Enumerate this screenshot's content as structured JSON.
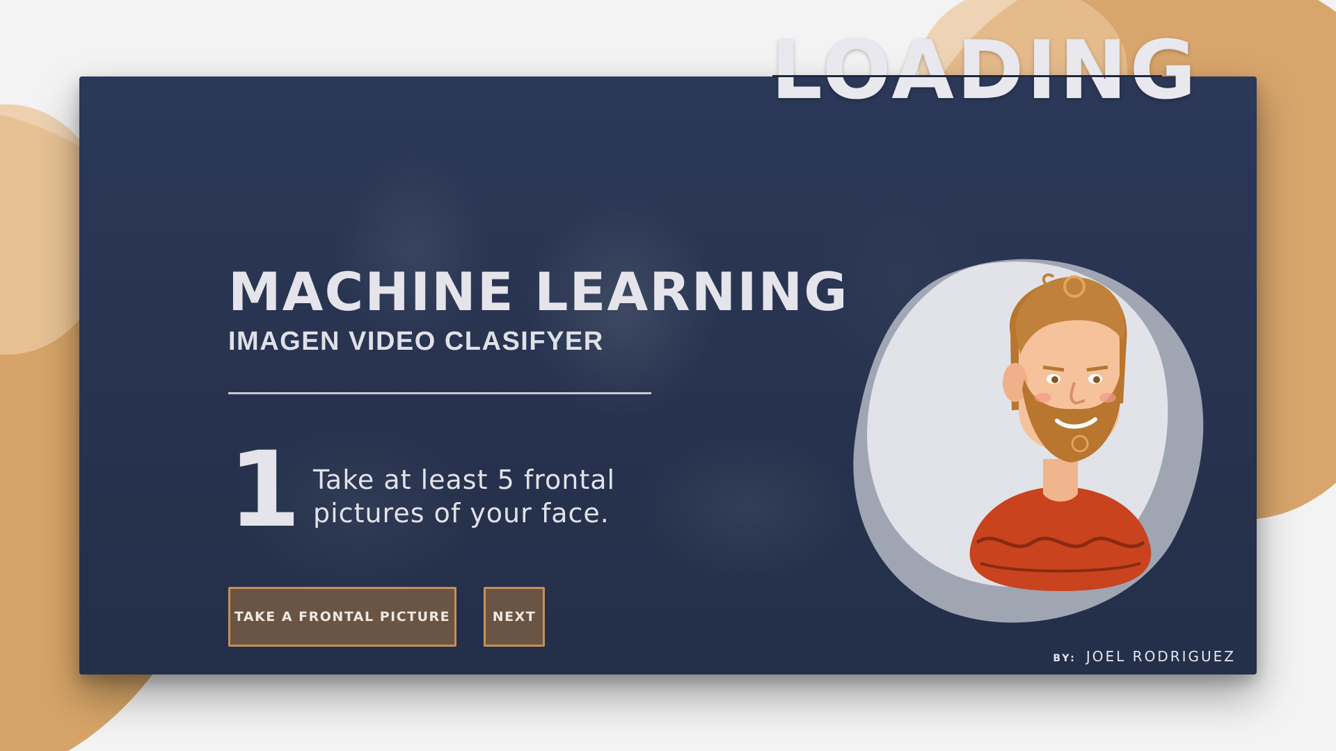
{
  "loading": {
    "label": "LOADING"
  },
  "header": {
    "title": "MACHINE LEARNING",
    "subtitle": "IMAGEN VIDEO CLASIFYER"
  },
  "step": {
    "number": "1",
    "instruction": "Take at least 5 frontal pictures of your face."
  },
  "buttons": {
    "take_picture": "TAKE A FRONTAL PICTURE",
    "next": "NEXT"
  },
  "author": {
    "by_label": "BY:",
    "name": "JOEL RODRIGUEZ"
  },
  "colors": {
    "card_bg": "#283452",
    "accent_tan": "#d8a56c",
    "button_border": "#c79055",
    "button_bg": "#6a5444",
    "text_light": "#e4e4ea"
  },
  "icons": {
    "avatar": "bearded-man-avatar"
  }
}
